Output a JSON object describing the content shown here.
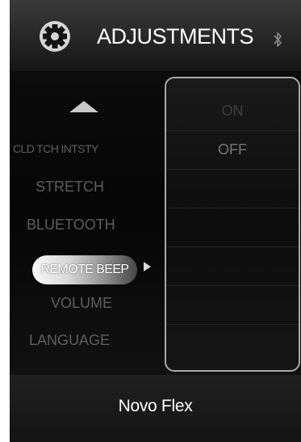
{
  "header": {
    "title": "ADJUSTMENTS",
    "settings_icon": "gear-icon",
    "status_icon": "bluetooth-icon"
  },
  "menu": {
    "items": [
      {
        "label": "CLD TCH INTSTY"
      },
      {
        "label": "STRETCH"
      },
      {
        "label": "BLUETOOTH"
      },
      {
        "label": "REMOTE BEEP",
        "selected": true
      },
      {
        "label": "VOLUME"
      },
      {
        "label": "LANGUAGE"
      }
    ],
    "scroll_up_icon": "triangle-up-icon",
    "selection_indicator_icon": "triangle-right-icon"
  },
  "options": {
    "items": [
      {
        "label": "ON"
      },
      {
        "label": "OFF"
      },
      {
        "label": ""
      },
      {
        "label": ""
      },
      {
        "label": ""
      },
      {
        "label": ""
      },
      {
        "label": ""
      }
    ]
  },
  "footer": {
    "label": "Novo Flex"
  },
  "colors": {
    "background": "#000000",
    "text_primary": "#ffffff",
    "text_dim": "#5e5e5e",
    "panel_border": "#a9a9a9"
  }
}
